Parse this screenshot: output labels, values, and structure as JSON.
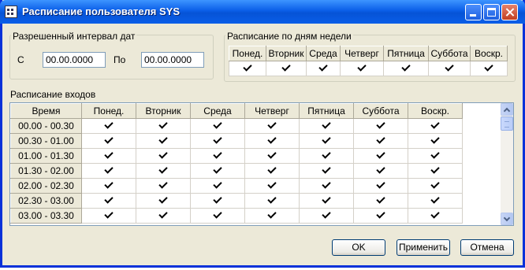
{
  "window": {
    "title": "Расписание пользователя SYS"
  },
  "date_range": {
    "group_label": "Разрешенный интервал дат",
    "from_label": "С",
    "from_value": "00.00.0000",
    "to_label": "По",
    "to_value": "00.00.0000"
  },
  "weekly": {
    "group_label": "Расписание по дням недели",
    "days": [
      "Понед.",
      "Вторник",
      "Среда",
      "Четверг",
      "Пятница",
      "Суббота",
      "Воскр."
    ],
    "checked": [
      true,
      true,
      true,
      true,
      true,
      true,
      true
    ]
  },
  "entries": {
    "group_label": "Расписание входов",
    "time_header": "Время",
    "days": [
      "Понед.",
      "Вторник",
      "Среда",
      "Четверг",
      "Пятница",
      "Суббота",
      "Воскр."
    ],
    "rows": [
      {
        "time": "00.00 - 00.30",
        "checked": [
          true,
          true,
          true,
          true,
          true,
          true,
          true
        ]
      },
      {
        "time": "00.30 - 01.00",
        "checked": [
          true,
          true,
          true,
          true,
          true,
          true,
          true
        ]
      },
      {
        "time": "01.00 - 01.30",
        "checked": [
          true,
          true,
          true,
          true,
          true,
          true,
          true
        ]
      },
      {
        "time": "01.30 - 02.00",
        "checked": [
          true,
          true,
          true,
          true,
          true,
          true,
          true
        ]
      },
      {
        "time": "02.00 - 02.30",
        "checked": [
          true,
          true,
          true,
          true,
          true,
          true,
          true
        ]
      },
      {
        "time": "02.30 - 03.00",
        "checked": [
          true,
          true,
          true,
          true,
          true,
          true,
          true
        ]
      },
      {
        "time": "03.00 - 03.30",
        "checked": [
          true,
          true,
          true,
          true,
          true,
          true,
          true
        ]
      }
    ]
  },
  "buttons": {
    "ok": "OK",
    "apply": "Применить",
    "cancel": "Отмена"
  }
}
